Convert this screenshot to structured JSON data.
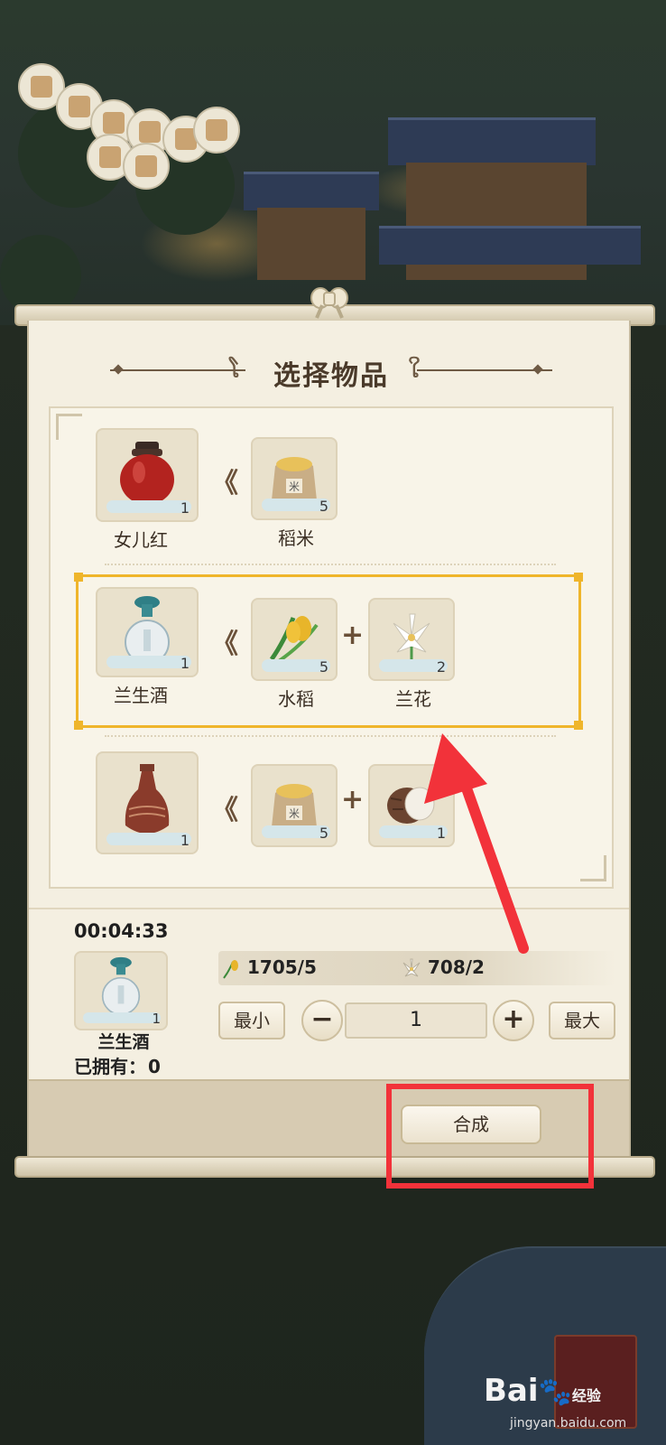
{
  "dialog": {
    "title": "选择物品",
    "recipes": [
      {
        "result": {
          "name": "女儿红",
          "qty": "1",
          "icon": "red-wine-jar-icon"
        },
        "ingredients": [
          {
            "name": "稻米",
            "qty": "5",
            "icon": "rice-sack-icon"
          }
        ]
      },
      {
        "result": {
          "name": "兰生酒",
          "qty": "1",
          "icon": "blue-wine-bottle-icon"
        },
        "ingredients": [
          {
            "name": "水稻",
            "qty": "5",
            "icon": "rice-plant-icon"
          },
          {
            "name": "兰花",
            "qty": "2",
            "icon": "orchid-icon"
          }
        ],
        "selected": true
      },
      {
        "result": {
          "name": "",
          "qty": "1",
          "icon": "brown-wine-bottle-icon"
        },
        "ingredients": [
          {
            "name": "",
            "qty": "5",
            "icon": "rice-sack-icon"
          },
          {
            "name": "",
            "qty": "1",
            "icon": "taro-icon"
          }
        ]
      }
    ],
    "detail": {
      "timer": "00:04:33",
      "selected_name": "兰生酒",
      "selected_qty": "1",
      "owned_label": "已拥有：",
      "owned_value": "0",
      "resources": [
        {
          "icon": "rice-plant-icon",
          "text": "1705/5"
        },
        {
          "icon": "orchid-icon",
          "text": "708/2"
        }
      ],
      "min_label": "最小",
      "max_label": "最大",
      "minus_label": "−",
      "plus_label": "+",
      "quantity": "1"
    },
    "synth_label": "合成"
  },
  "watermark": {
    "brand": "Bai",
    "brand2": "经验",
    "site": "jingyan.baidu.com"
  },
  "colors": {
    "selection_frame": "#efb52b",
    "annotation_red": "#f2323a",
    "panel_bg": "#f4efe1"
  }
}
